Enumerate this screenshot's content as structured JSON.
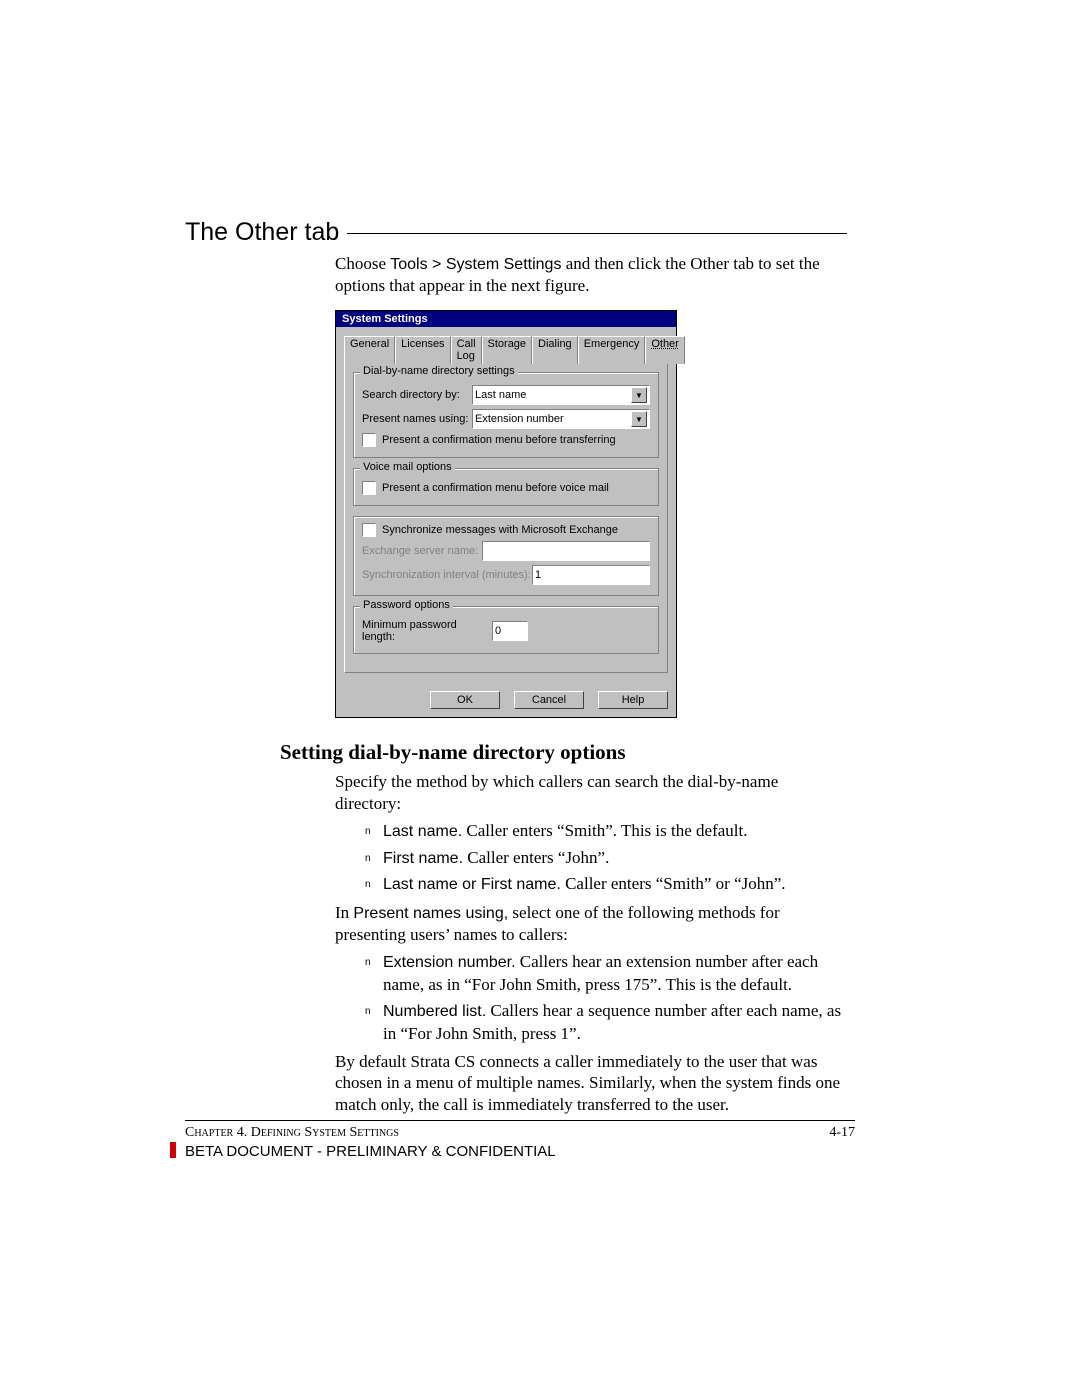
{
  "heading": "The Other tab",
  "intro_pre": "Choose ",
  "intro_cmd": "Tools > System Settings",
  "intro_post": " and then click the Other tab to set the options that appear in the next figure.",
  "dialog": {
    "title": "System Settings",
    "tabs": [
      "General",
      "Licenses",
      "Call Log",
      "Storage",
      "Dialing",
      "Emergency",
      "Other"
    ],
    "group_dial": {
      "legend": "Dial-by-name directory settings",
      "search_label": "Search directory by:",
      "search_value": "Last name",
      "present_label": "Present names using:",
      "present_value": "Extension number",
      "confirm_label": "Present a confirmation menu before transferring"
    },
    "group_vm": {
      "legend": "Voice mail options",
      "confirm_label": "Present a confirmation menu before voice mail"
    },
    "group_sync": {
      "check_label": "Synchronize messages with Microsoft Exchange",
      "server_label": "Exchange server name:",
      "server_value": "",
      "interval_label": "Synchronization interval (minutes):",
      "interval_value": "1"
    },
    "group_pwd": {
      "legend": "Password options",
      "min_label": "Minimum password length:",
      "min_value": "0"
    },
    "buttons": {
      "ok": "OK",
      "cancel": "Cancel",
      "help": "Help"
    }
  },
  "subheading": "Setting dial-by-name directory options",
  "sub_intro": "Specify the method by which callers can search the dial-by-name directory:",
  "list1": {
    "a_bold": "Last name.",
    "a_rest": " Caller enters “Smith”. This is the default.",
    "b_bold": "First name.",
    "b_rest": " Caller enters “John”.",
    "c_bold": "Last name or First name.",
    "c_rest": " Caller enters “Smith” or “John”."
  },
  "para2_pre": "In ",
  "para2_bold": "Present names using,",
  "para2_post": " select one of the following methods for presenting users’ names to callers:",
  "list2": {
    "a_bold": "Extension number.",
    "a_rest": " Callers hear an extension number after each name, as in “For John Smith, press 175”. This is the default.",
    "b_bold": "Numbered list.",
    "b_rest": " Callers hear a sequence number after each name, as in “For John Smith, press 1”."
  },
  "para3": "By default Strata CS connects a caller immediately to the user that was chosen in a menu of multiple names. Similarly, when the system finds one match only, the call is immediately transferred to the user.",
  "footer": {
    "chapter": "Chapter 4. Defining System Settings",
    "page": "4-17",
    "beta": "BETA DOCUMENT - PRELIMINARY & CONFIDENTIAL"
  }
}
